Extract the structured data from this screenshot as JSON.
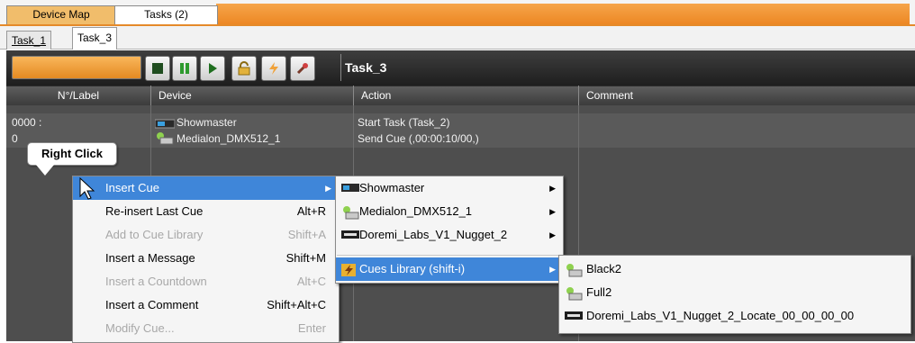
{
  "top_tabs": [
    "Device Map",
    "Tasks (2)"
  ],
  "sub_tabs": [
    "Task_1",
    "Task_3"
  ],
  "toolbar": {
    "task_name": "Task_3"
  },
  "columns": [
    "N°/Label",
    "Device",
    "Action",
    "Comment"
  ],
  "rows": [
    {
      "label": "0000 :",
      "device": "Showmaster",
      "action": "Start Task (Task_2)"
    },
    {
      "label": "0",
      "device": "Medialon_DMX512_1",
      "action": "Send Cue (,00:00:10/00,)"
    }
  ],
  "callout": "Right Click",
  "context_menu": [
    {
      "label": "Insert Cue",
      "shortcut": "",
      "enabled": true
    },
    {
      "label": "Re-insert Last Cue",
      "shortcut": "Alt+R",
      "enabled": true
    },
    {
      "label": "Add to Cue Library",
      "shortcut": "Shift+A",
      "enabled": false
    },
    {
      "label": "Insert a Message",
      "shortcut": "Shift+M",
      "enabled": true
    },
    {
      "label": "Insert a Countdown",
      "shortcut": "Alt+C",
      "enabled": false
    },
    {
      "label": "Insert a Comment",
      "shortcut": "Shift+Alt+C",
      "enabled": true
    },
    {
      "label": "Modify Cue...",
      "shortcut": "Enter",
      "enabled": false
    }
  ],
  "submenu_devices": [
    "Showmaster",
    "Medialon_DMX512_1",
    "Doremi_Labs_V1_Nugget_2",
    "Cues Library (shift-i)"
  ],
  "submenu_cues": [
    "Black2",
    "Full2",
    "Doremi_Labs_V1_Nugget_2_Locate_00_00_00_00"
  ],
  "colors": {
    "accent_orange": "#ec8622",
    "menu_selection": "#3f86d9",
    "grid_bg": "#4e4e4e"
  }
}
